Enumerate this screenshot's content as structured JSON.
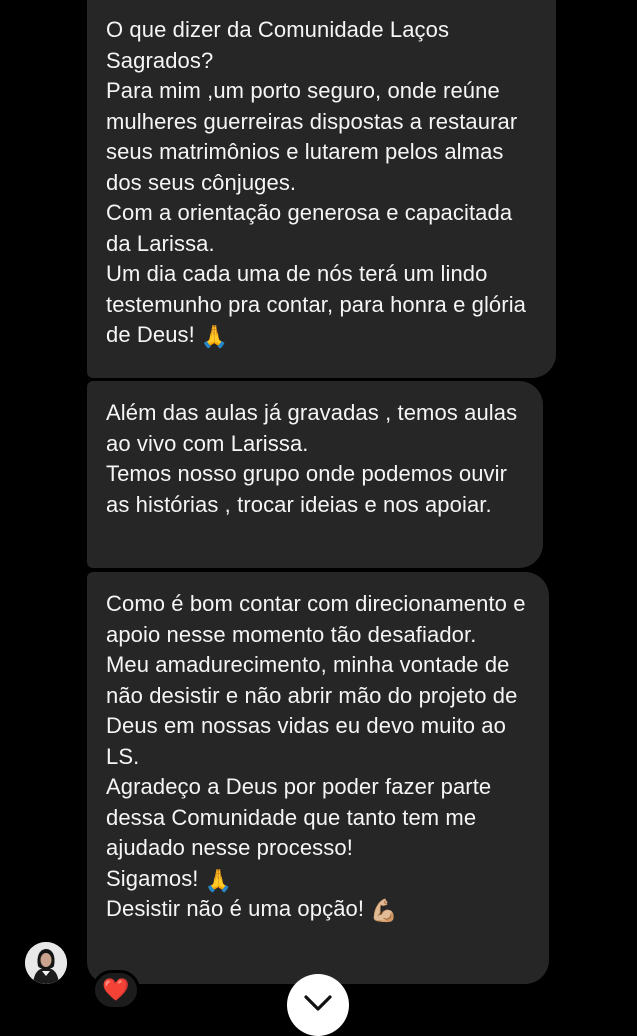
{
  "messages": [
    {
      "paragraphs": [
        "O que dizer da Comunidade Laços Sagrados?",
        "Para mim ,um porto seguro, onde reúne mulheres guerreiras dispostas a restaurar seus matrimônios e lutarem pelos almas dos seus cônjuges.",
        "Com a orientação generosa e capacitada da Larissa.",
        "Um dia cada uma de nós terá um lindo testemunho pra contar, para honra e glória de Deus!"
      ],
      "emoji": "🙏"
    },
    {
      "paragraphs": [
        "Além das aulas já gravadas , temos aulas ao vivo com Larissa.",
        "Temos nosso grupo  onde podemos ouvir as histórias , trocar ideias e nos apoiar."
      ]
    },
    {
      "paragraphs": [
        "Como é bom contar com direcionamento e apoio nesse momento tão desafiador.",
        "Meu amadurecimento, minha vontade de não desistir e não abrir mão do projeto de Deus em nossas vidas eu devo muito ao LS.",
        "Agradeço a Deus por poder fazer parte dessa Comunidade que tanto tem me ajudado nesse processo!",
        "Sigamos!",
        "Desistir não é uma opção!"
      ],
      "emoji_sigamos": "🙏",
      "emoji_last": "💪🏼"
    }
  ],
  "reaction": {
    "emoji": "❤️"
  },
  "colors": {
    "background": "#000000",
    "bubble": "#262626",
    "text": "#f5f5f5",
    "heart": "#ff2a2a"
  },
  "icons": {
    "reaction": "heart-icon",
    "scroll": "chevron-down-icon",
    "avatar": "profile-avatar"
  }
}
